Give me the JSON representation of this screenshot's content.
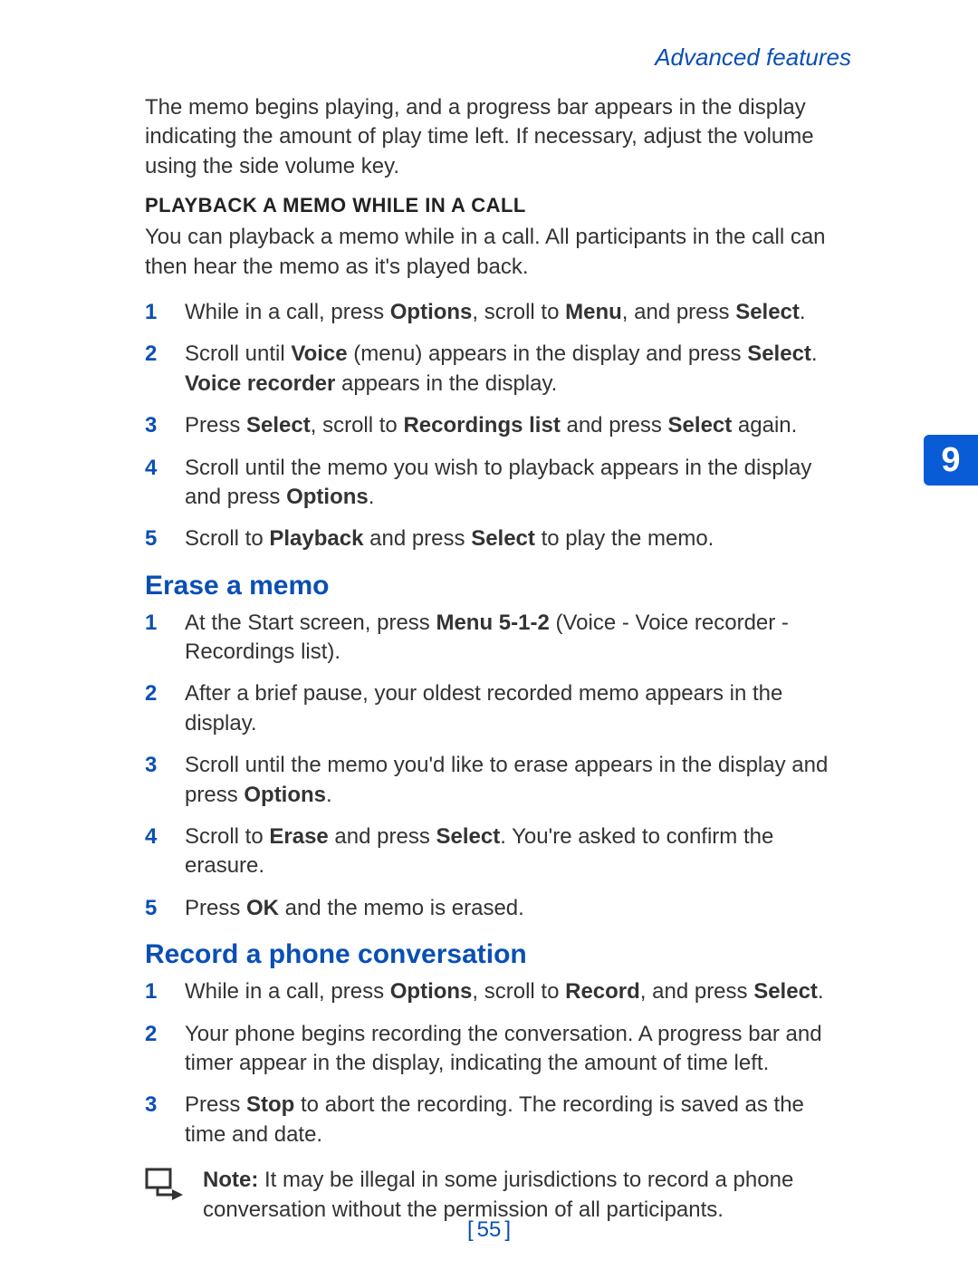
{
  "header": {
    "section_label": "Advanced features"
  },
  "intro_paragraph": "The memo begins playing, and a progress bar appears in the display indicating the amount of play time left. If necessary, adjust the volume using the side volume key.",
  "playback_section": {
    "heading": "PLAYBACK A MEMO WHILE IN A CALL",
    "intro": "You can playback a memo while in a call. All participants in the call can then hear the memo as it's played back.",
    "steps": [
      {
        "n": "1",
        "parts": [
          "While in a call, press ",
          "Options",
          ", scroll to ",
          "Menu",
          ", and press ",
          "Select",
          "."
        ]
      },
      {
        "n": "2",
        "parts": [
          "Scroll until ",
          "Voice",
          " (menu) appears in the display and press ",
          "Select",
          ". ",
          "Voice recorder",
          " appears in the display."
        ]
      },
      {
        "n": "3",
        "parts": [
          "Press ",
          "Select",
          ", scroll to ",
          "Recordings list",
          " and press ",
          "Select",
          " again."
        ]
      },
      {
        "n": "4",
        "parts": [
          "Scroll until the memo you wish to playback appears in the display and press ",
          "Options",
          "."
        ]
      },
      {
        "n": "5",
        "parts": [
          "Scroll to ",
          "Playback",
          " and press ",
          "Select",
          " to play the memo."
        ]
      }
    ]
  },
  "erase_section": {
    "heading": "Erase a memo",
    "steps": [
      {
        "n": "1",
        "parts": [
          "At the Start screen, press ",
          "Menu 5-1-2",
          " (Voice - Voice recorder - Recordings list)."
        ]
      },
      {
        "n": "2",
        "parts": [
          "After a brief pause, your oldest recorded memo appears in the display."
        ]
      },
      {
        "n": "3",
        "parts": [
          "Scroll until the memo you'd like to erase appears in the display and press ",
          "Options",
          "."
        ]
      },
      {
        "n": "4",
        "parts": [
          "Scroll to ",
          "Erase",
          " and press ",
          "Select",
          ". You're asked to confirm the erasure."
        ]
      },
      {
        "n": "5",
        "parts": [
          "Press ",
          "OK",
          " and the memo is erased."
        ]
      }
    ]
  },
  "record_section": {
    "heading": "Record a phone conversation",
    "steps": [
      {
        "n": "1",
        "parts": [
          "While in a call, press ",
          "Options",
          ", scroll to ",
          "Record",
          ", and press ",
          "Select",
          "."
        ]
      },
      {
        "n": "2",
        "parts": [
          "Your phone begins recording the conversation. A progress bar and timer appear in the display, indicating the amount of time left."
        ]
      },
      {
        "n": "3",
        "parts": [
          "Press ",
          "Stop",
          " to abort the recording. The recording is saved as the time and date."
        ]
      }
    ],
    "note_label": "Note:",
    "note_text": " It may be illegal in some jurisdictions to record a phone conversation without the permission of all participants."
  },
  "side_tab": "9",
  "page_number": "55"
}
